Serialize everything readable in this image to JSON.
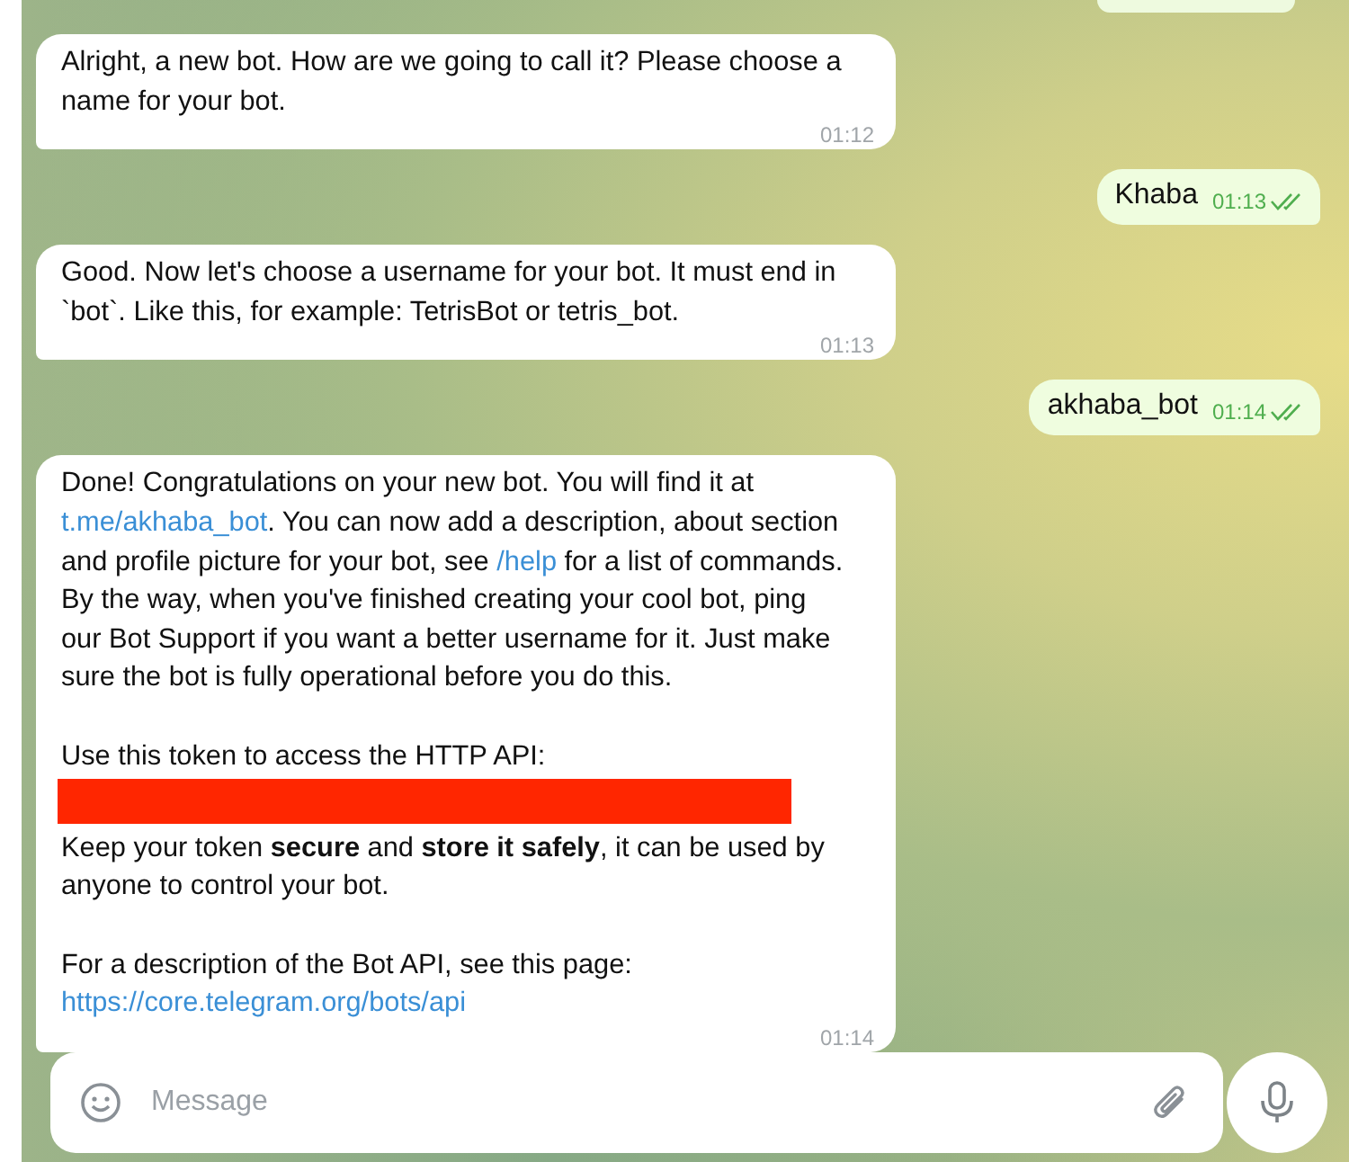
{
  "messages": [
    {
      "kind": "incoming",
      "time": "01:12",
      "paragraphs": [
        [
          {
            "kind": "text",
            "segments": [
              {
                "kind": "text",
                "text": "Alright, a new bot. How are we going to call it? Please choose a name for your bot."
              }
            ]
          }
        ]
      ]
    },
    {
      "kind": "outgoing",
      "time": "01:13",
      "read": true,
      "text": "Khaba"
    },
    {
      "kind": "incoming",
      "time": "01:13",
      "paragraphs": [
        [
          {
            "kind": "text",
            "segments": [
              {
                "kind": "text",
                "text": "Good. Now let's choose a username for your bot. It must end in `bot`. Like this, for example: TetrisBot or tetris_bot."
              }
            ]
          }
        ]
      ]
    },
    {
      "kind": "outgoing",
      "time": "01:14",
      "read": true,
      "text": "akhaba_bot"
    },
    {
      "kind": "incoming",
      "time": "01:14",
      "paragraphs": [
        [
          {
            "kind": "text",
            "segments": [
              {
                "kind": "text",
                "text": "Done! Congratulations on your new bot. You will find it at "
              },
              {
                "kind": "link",
                "text": "t.me/akhaba_bot"
              },
              {
                "kind": "text",
                "text": ". You can now add a description, about section and profile picture for your bot, see "
              },
              {
                "kind": "link",
                "text": "/help"
              },
              {
                "kind": "text",
                "text": " for a list of commands. By the way, when you've finished creating your cool bot, ping our Bot Support if you want a better username for it. Just make sure the bot is fully operational before you do this."
              }
            ]
          }
        ],
        [
          {
            "kind": "text",
            "segments": [
              {
                "kind": "text",
                "text": "Use this token to access the HTTP API:"
              }
            ]
          },
          {
            "kind": "redacted"
          },
          {
            "kind": "text",
            "segments": [
              {
                "kind": "text",
                "text": "Keep your token **secure** and **store it safely**, it can be used by anyone to control your bot."
              }
            ]
          }
        ],
        [
          {
            "kind": "text",
            "segments": [
              {
                "kind": "text",
                "text": "For a description of the Bot API, see this page: "
              },
              {
                "kind": "link",
                "text": "https://core.telegram.org/bots/api"
              }
            ]
          }
        ]
      ]
    }
  ],
  "composer": {
    "placeholder": "Message"
  }
}
